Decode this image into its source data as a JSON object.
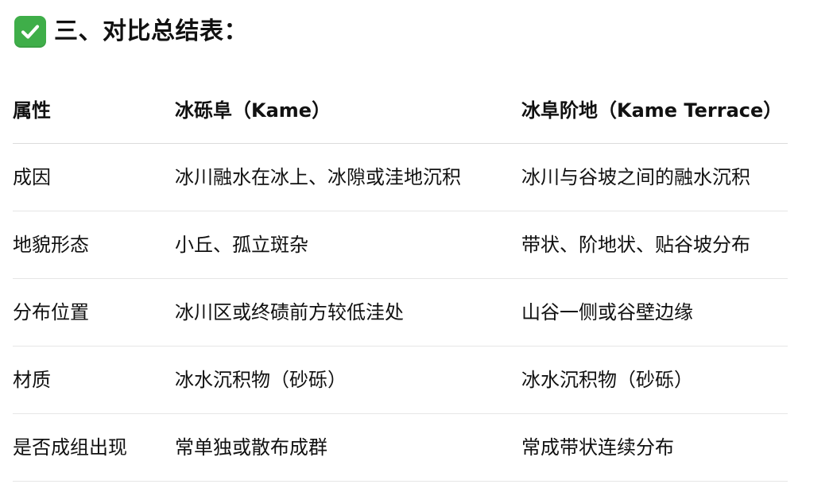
{
  "heading": {
    "icon": "check-mark-button-icon",
    "icon_color": "#3fae49",
    "text": "三、对比总结表："
  },
  "table": {
    "columns": [
      "属性",
      "冰砾阜（Kame）",
      "冰阜阶地（Kame Terrace）"
    ],
    "rows": [
      [
        "成因",
        "冰川融水在冰上、冰隙或洼地沉积",
        "冰川与谷坡之间的融水沉积"
      ],
      [
        "地貌形态",
        "小丘、孤立斑杂",
        "带状、阶地状、贴谷坡分布"
      ],
      [
        "分布位置",
        "冰川区或终碛前方较低洼处",
        "山谷一侧或谷壁边缘"
      ],
      [
        "材质",
        "冰水沉积物（砂砾）",
        "冰水沉积物（砂砾）"
      ],
      [
        "是否成组出现",
        "常单独或散布成群",
        "常成带状连续分布"
      ]
    ]
  }
}
